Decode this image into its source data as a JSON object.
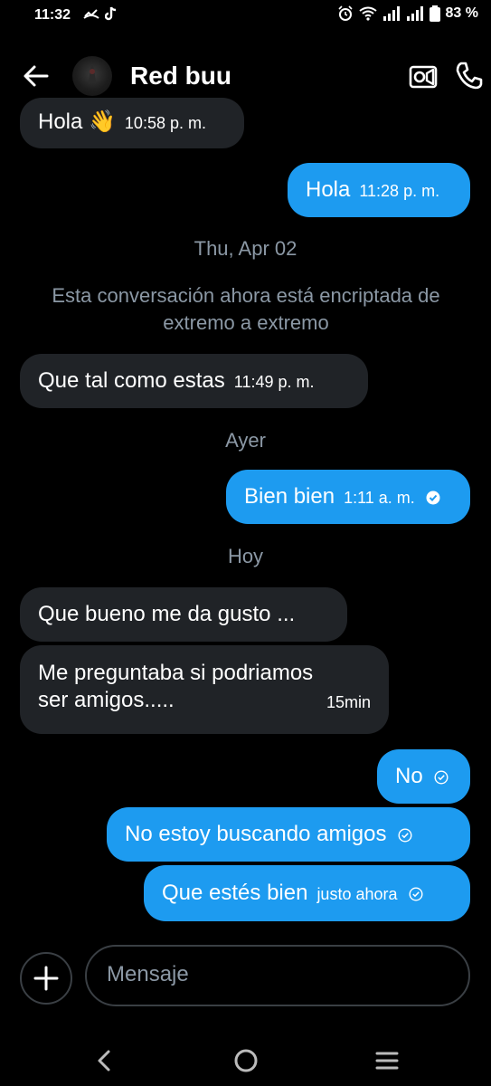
{
  "status": {
    "time": "11:32",
    "battery": "83 %"
  },
  "header": {
    "contact_name": "Red buu"
  },
  "messages": [
    {
      "text": "Hola 👋",
      "time": "10:58 p. m."
    },
    {
      "text": "Hola",
      "time": "11:28 p. m."
    },
    {
      "separator": "Thu, Apr 02"
    },
    {
      "system": "Esta conversación ahora está encriptada de extremo a extremo"
    },
    {
      "text": "Que tal como estas",
      "time": "11:49 p. m."
    },
    {
      "separator": "Ayer"
    },
    {
      "text": "Bien bien",
      "time": "1:11 a. m."
    },
    {
      "separator": "Hoy"
    },
    {
      "text": "Que bueno me da gusto ..."
    },
    {
      "text_line1": "Me preguntaba si podriamos",
      "text_line2": "ser amigos.....",
      "time": "15min"
    },
    {
      "text": "No"
    },
    {
      "text": "No estoy buscando amigos"
    },
    {
      "text": "Que estés bien",
      "time": "justo ahora"
    }
  ],
  "composer": {
    "placeholder": "Mensaje"
  },
  "icons": {
    "back": "arrow-left-icon",
    "video": "video-camera-icon",
    "call": "phone-icon",
    "plus": "plus-icon",
    "nav_back": "chevron-left-icon",
    "nav_home": "circle-icon",
    "nav_menu": "menu-icon"
  },
  "colors": {
    "outgoing_bubble": "#1d9bf0",
    "incoming_bubble": "#202327",
    "background": "#000000",
    "muted_text": "#8b98a5"
  }
}
